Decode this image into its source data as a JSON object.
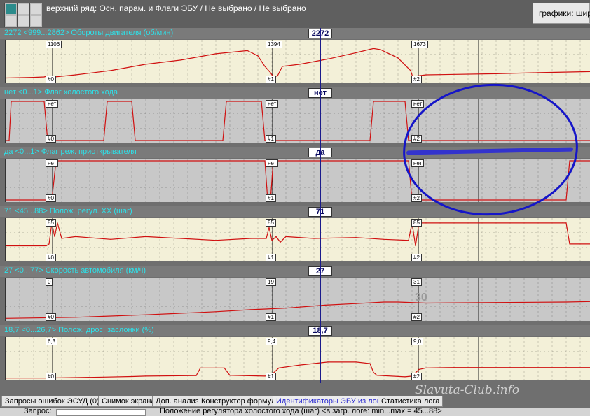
{
  "header": {
    "breadcrumb": "верхний ряд: Осн. парам. и Флаги ЭБУ / Не выбрано / Не выбрано",
    "graphs_label": "графики:  шир"
  },
  "colors": {
    "trace": "#d01010",
    "cursor": "#1a1a8c",
    "header_text": "#2ee0e8",
    "annotation_ring": "#1515c8"
  },
  "markers": [
    "#0",
    "#1",
    "#2"
  ],
  "chart_data": [
    {
      "type": "line",
      "title": "2272   <999...2862>  Обороты двигателя (об/мин)",
      "cursor_value": "2272",
      "marker_values": [
        "1106",
        "1394",
        "1673"
      ],
      "ylim": [
        999,
        2862
      ],
      "background": "#f3f0d8",
      "x": [
        0,
        40,
        55,
        60,
        64,
        70,
        100,
        150,
        200,
        250,
        300,
        345,
        360,
        370,
        378,
        382,
        388,
        395,
        420,
        460,
        500,
        525,
        535,
        560,
        578,
        582,
        588,
        600,
        700,
        760,
        835
      ],
      "values": [
        1150,
        1180,
        1200,
        1250,
        1100,
        1200,
        1300,
        1500,
        1800,
        2000,
        2300,
        2450,
        2200,
        1700,
        1400,
        1200,
        1250,
        1700,
        1800,
        2050,
        2350,
        2550,
        2500,
        2100,
        1500,
        1100,
        1250,
        1300,
        1350,
        1400,
        1450
      ]
    },
    {
      "type": "line",
      "title": "нет   <0...1>  Флаг холостого хода",
      "cursor_value": "нет",
      "marker_values": [
        "нет",
        "нет",
        "нет"
      ],
      "ylim": [
        0,
        1
      ],
      "background": "#c8c8c8",
      "x": [
        0,
        5,
        8,
        55,
        60,
        64,
        140,
        145,
        180,
        185,
        310,
        315,
        365,
        370,
        375,
        520,
        525,
        570,
        575,
        580,
        835
      ],
      "values": [
        0,
        0,
        1,
        1,
        0,
        0,
        0,
        1,
        1,
        0,
        0,
        1,
        1,
        0,
        0,
        0,
        1,
        1,
        0,
        0,
        0
      ]
    },
    {
      "type": "line",
      "title": "да   <0...1>  Флаг реж. приоткрывателя",
      "cursor_value": "да",
      "marker_values": [
        "нет",
        "нет",
        "нет"
      ],
      "ylim": [
        0,
        1
      ],
      "background": "#c8c8c8",
      "x": [
        0,
        60,
        66,
        72,
        370,
        374,
        378,
        382,
        575,
        580,
        585,
        800,
        805,
        835
      ],
      "values": [
        0,
        0,
        0,
        1,
        1,
        0,
        0,
        1,
        1,
        0,
        0,
        0,
        1,
        1
      ]
    },
    {
      "type": "line",
      "title": "71   <45...88>  Полож. регул. ХХ (шаг)",
      "cursor_value": "71",
      "marker_values": [
        "85",
        "85",
        "85"
      ],
      "ylim": [
        45,
        88
      ],
      "background": "#f3f0d8",
      "x": [
        0,
        58,
        62,
        66,
        70,
        74,
        80,
        100,
        150,
        200,
        250,
        300,
        350,
        372,
        376,
        380,
        386,
        392,
        400,
        440,
        500,
        540,
        575,
        580,
        585,
        590,
        600,
        795,
        800,
        805,
        835
      ],
      "values": [
        60,
        60,
        62,
        85,
        70,
        85,
        68,
        70,
        67,
        70,
        68,
        66,
        68,
        68,
        80,
        66,
        70,
        64,
        70,
        68,
        69,
        67,
        66,
        85,
        60,
        85,
        85,
        85,
        85,
        62,
        62
      ]
    },
    {
      "type": "line",
      "title": "27   <0...77>  Скорость автомобиля (км/ч)",
      "cursor_value": "27",
      "marker_values": [
        "0",
        "19",
        "31"
      ],
      "ylim": [
        0,
        77
      ],
      "background": "#c8c8c8",
      "x": [
        0,
        100,
        200,
        300,
        350,
        400,
        456,
        500,
        540,
        560,
        600,
        700,
        800,
        835
      ],
      "values": [
        1,
        3,
        8,
        14,
        18,
        21,
        27,
        30,
        33,
        33,
        31,
        32,
        33,
        34
      ],
      "annotation": "30"
    },
    {
      "type": "line",
      "title": "18,7   <0...26,7>  Полож. дрос. заслонки (%)",
      "cursor_value": "18,7",
      "marker_values": [
        "6,3",
        "9,4",
        "9,0"
      ],
      "ylim": [
        0,
        26.7
      ],
      "background": "#f3f0d8",
      "x": [
        0,
        60,
        100,
        140,
        180,
        200,
        272,
        278,
        300,
        312,
        320,
        370,
        378,
        390,
        420,
        460,
        500,
        520,
        525,
        530,
        570,
        580,
        590,
        600,
        640,
        720,
        835
      ],
      "values": [
        0.2,
        0.2,
        0.5,
        0.8,
        1.2,
        1.5,
        1.8,
        7,
        7,
        7,
        2,
        1.5,
        1.8,
        7,
        9,
        11,
        11,
        10,
        4,
        2,
        1,
        1.5,
        6,
        7,
        7.3,
        7.3,
        7.3
      ]
    }
  ],
  "bottom_tabs": [
    "Запросы ошибок ЭСУД (0)",
    "Снимок экрана",
    "Доп. анализ",
    "Конструктор формул",
    "Идентификаторы ЭБУ из лога",
    "Статистика лога"
  ],
  "status": {
    "query_label": "Запрос:",
    "message": "Положение регулятора холостого хода (шаг) <в загр. логе: min...max = 45...88>"
  },
  "watermark": "Slavuta-Club.info"
}
